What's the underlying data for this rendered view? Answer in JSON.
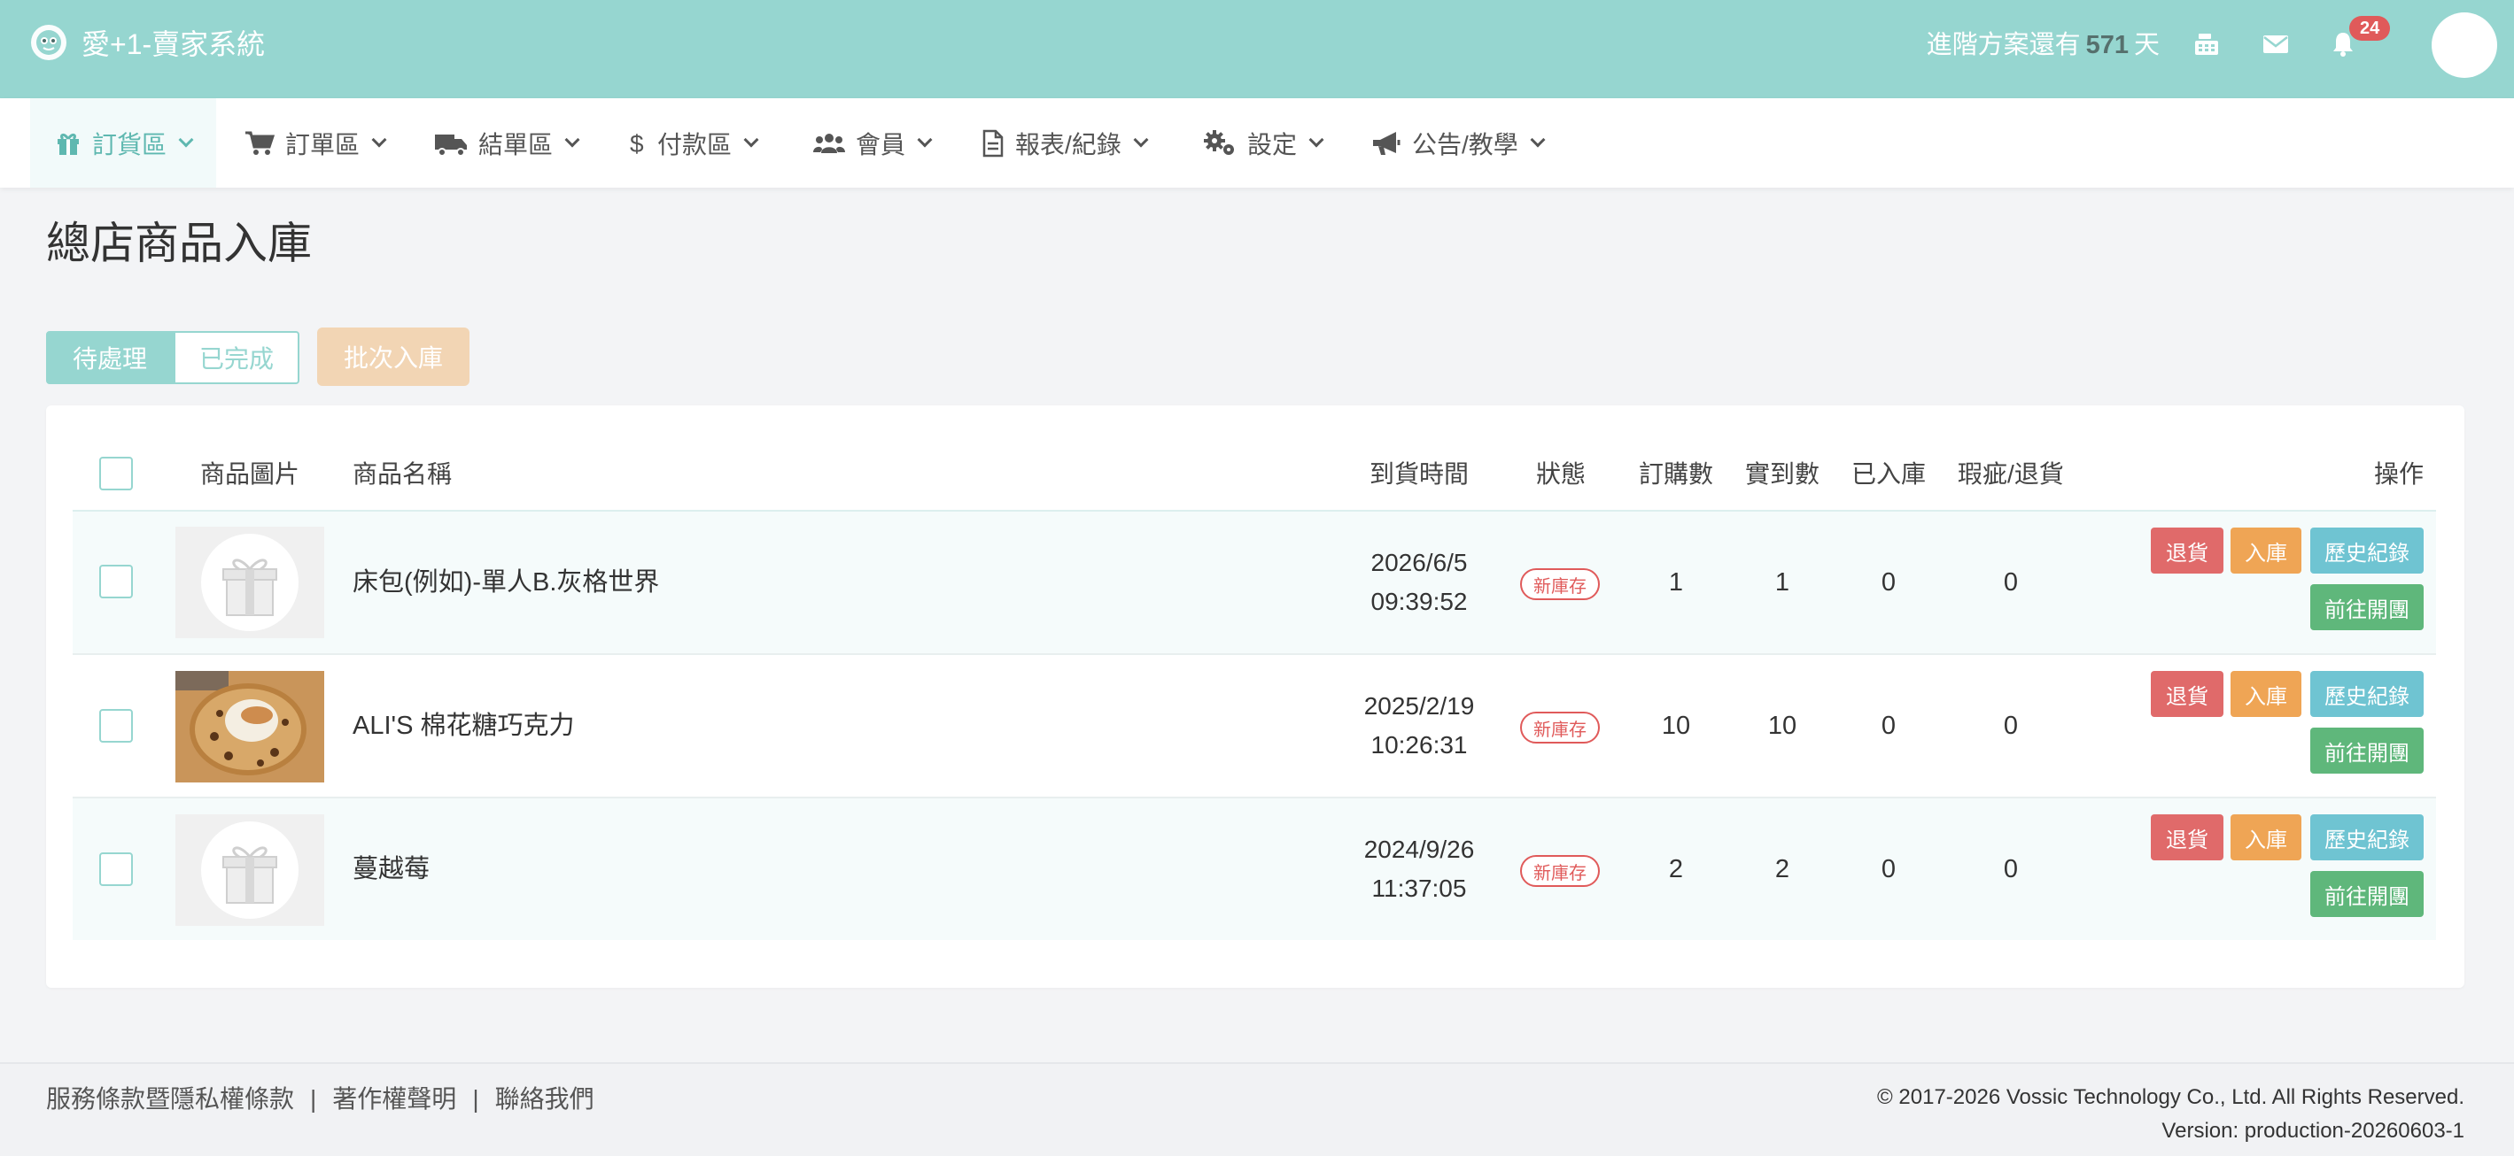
{
  "app": {
    "title": "愛+1-賣家系統"
  },
  "header": {
    "plan_prefix": "進階方案還有",
    "plan_days": "571",
    "plan_suffix": "天",
    "notification_count": "24",
    "icons": [
      "cash-register-icon",
      "mail-icon",
      "bell-icon"
    ]
  },
  "nav": {
    "items": [
      {
        "label": "訂貨區",
        "icon": "gift-icon",
        "active": true
      },
      {
        "label": "訂單區",
        "icon": "cart-icon"
      },
      {
        "label": "結單區",
        "icon": "truck-icon"
      },
      {
        "label": "付款區",
        "icon": "dollar-icon"
      },
      {
        "label": "會員",
        "icon": "users-icon"
      },
      {
        "label": "報表/紀錄",
        "icon": "document-icon"
      },
      {
        "label": "設定",
        "icon": "gears-icon"
      },
      {
        "label": "公告/教學",
        "icon": "megaphone-icon"
      }
    ]
  },
  "page": {
    "title": "總店商品入庫",
    "tabs": {
      "pending": "待處理",
      "done": "已完成"
    },
    "batch_button": "批次入庫"
  },
  "table": {
    "headers": {
      "image": "商品圖片",
      "name": "商品名稱",
      "arrival": "到貨時間",
      "status": "狀態",
      "ordered": "訂購數",
      "received": "實到數",
      "stocked": "已入庫",
      "defect": "瑕疵/退貨",
      "actions": "操作"
    },
    "rows": [
      {
        "name": "床包(例如)-單人B.灰格世界",
        "date": "2026/6/5",
        "time": "09:39:52",
        "status": "新庫存",
        "ordered": "1",
        "received": "1",
        "stocked": "0",
        "defect": "0",
        "image": "gift-placeholder"
      },
      {
        "name": "ALI'S 棉花糖巧克力",
        "date": "2025/2/19",
        "time": "10:26:31",
        "status": "新庫存",
        "ordered": "10",
        "received": "10",
        "stocked": "0",
        "defect": "0",
        "image": "marshmallow-cookie-photo"
      },
      {
        "name": "蔓越莓",
        "date": "2024/9/26",
        "time": "11:37:05",
        "status": "新庫存",
        "ordered": "2",
        "received": "2",
        "stocked": "0",
        "defect": "0",
        "image": "gift-placeholder"
      }
    ],
    "actions": {
      "return": "退貨",
      "stock": "入庫",
      "history": "歷史紀錄",
      "goto": "前往開團"
    }
  },
  "footer": {
    "links": [
      "服務條款暨隱私權條款",
      "著作權聲明",
      "聯絡我們"
    ],
    "separator": "|",
    "copyright": "© 2017-2026 Vossic Technology Co., Ltd. All Rights Reserved.",
    "version": "Version: production-20260603-1"
  },
  "colors": {
    "topbar": "#96d6d0",
    "accent": "#5fb8b0",
    "danger": "#e06a6a",
    "warning": "#efa555",
    "info": "#6fc4d2",
    "success": "#5fb77b"
  }
}
